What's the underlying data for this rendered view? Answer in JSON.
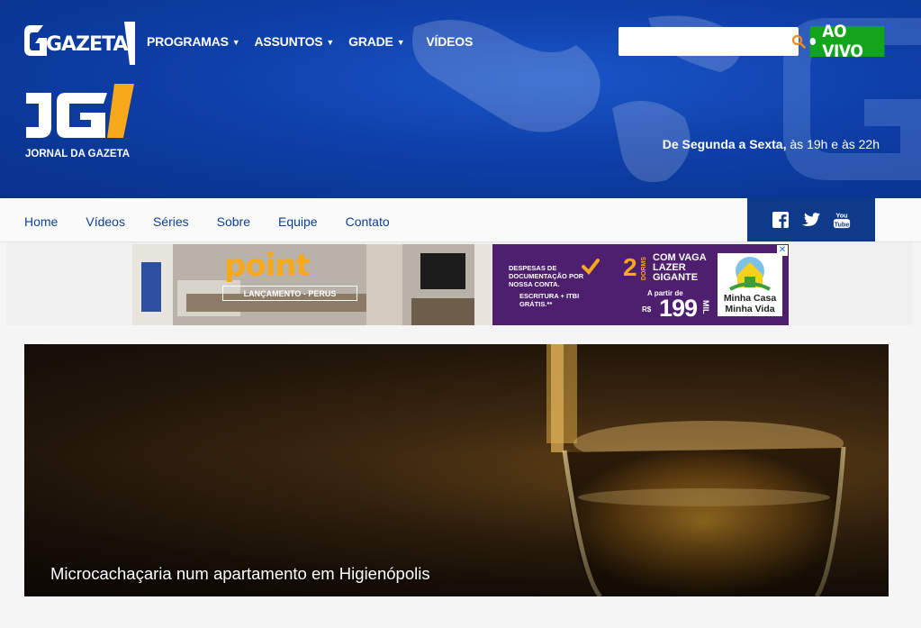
{
  "header": {
    "brand": "GAZETA",
    "nav": [
      {
        "label": "PROGRAMAS",
        "has_dropdown": true
      },
      {
        "label": "ASSUNTOS",
        "has_dropdown": true
      },
      {
        "label": "GRADE",
        "has_dropdown": true
      },
      {
        "label": "VÍDEOS",
        "has_dropdown": false
      }
    ],
    "search": {
      "placeholder": "",
      "value": "",
      "icon": "search-icon"
    },
    "live_button": "AO VIVO",
    "program_logo_caption": "JORNAL DA GAZETA",
    "schedule_bold": "De Segunda a Sexta,",
    "schedule_rest": " às 19h e às 22h"
  },
  "subnav": {
    "links": [
      "Home",
      "Vídeos",
      "Séries",
      "Sobre",
      "Equipe",
      "Contato"
    ],
    "social": [
      "facebook-icon",
      "twitter-icon",
      "youtube-icon"
    ]
  },
  "ad": {
    "brand": "point",
    "launch": "LANÇAMENTO - PERUS",
    "docs": "DESPESAS DE DOCUMENTAÇÃO POR NOSSA CONTA.",
    "escritura": "ESCRITURA + ITBI GRÁTIS.**",
    "dorms_number": "2",
    "dorms_label": "DORMS",
    "vaga": "COM VAGA LAZER GIGANTE",
    "a_partir": "A partir de",
    "currency": "R$",
    "price": "199",
    "mil": "MIL",
    "program": "Minha Casa Minha Vida",
    "close": "✕"
  },
  "feature": {
    "title": "Microcachaçaria num apartamento em Higienópolis"
  },
  "colors": {
    "header_blue": "#0e3fa8",
    "nav_link": "#0d3f94",
    "social_bg": "#0e3a8a",
    "live_green": "#12a51b",
    "search_icon": "#f08a1c"
  }
}
